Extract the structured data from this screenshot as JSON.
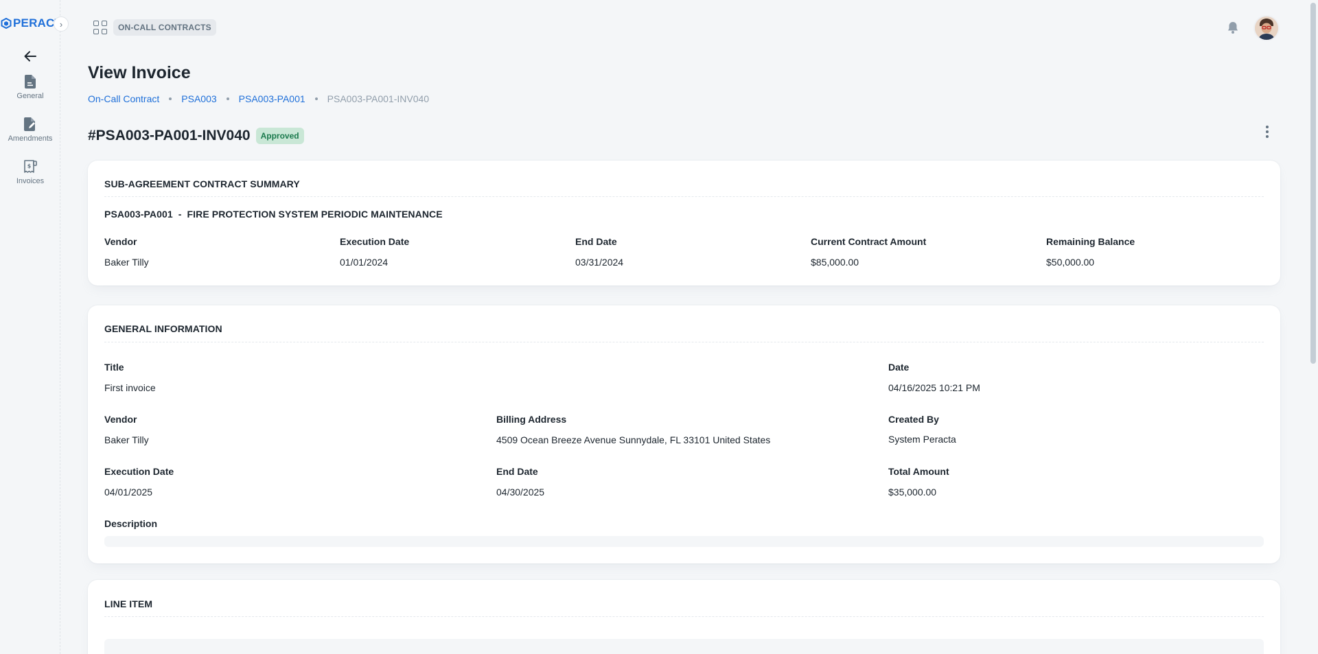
{
  "app": {
    "logo_text": "PERACT"
  },
  "sidebar": {
    "items": [
      {
        "label": "General",
        "icon": "document-icon"
      },
      {
        "label": "Amendments",
        "icon": "document-edit-icon"
      },
      {
        "label": "Invoices",
        "icon": "invoice-icon"
      }
    ]
  },
  "header": {
    "section_chip": "ON-CALL CONTRACTS"
  },
  "page": {
    "title": "View Invoice",
    "breadcrumb": [
      "On-Call Contract",
      "PSA003",
      "PSA003-PA001",
      "PSA003-PA001-INV040"
    ],
    "invoice_id": "#PSA003-PA001-INV040",
    "status": "Approved"
  },
  "summary": {
    "title": "SUB-AGREEMENT CONTRACT SUMMARY",
    "subtitle": "PSA003-PA001  -  FIRE PROTECTION SYSTEM PERIODIC MAINTENANCE",
    "fields": [
      {
        "label": "Vendor",
        "value": "Baker Tilly"
      },
      {
        "label": "Execution Date",
        "value": "01/01/2024"
      },
      {
        "label": "End Date",
        "value": "03/31/2024"
      },
      {
        "label": "Current Contract Amount",
        "value": "$85,000.00"
      },
      {
        "label": "Remaining Balance",
        "value": "$50,000.00"
      }
    ]
  },
  "general": {
    "title": "GENERAL INFORMATION",
    "title_field": {
      "label": "Title",
      "value": "First invoice"
    },
    "date": {
      "label": "Date",
      "value": "04/16/2025 10:21 PM"
    },
    "vendor": {
      "label": "Vendor",
      "value": "Baker Tilly"
    },
    "billing_address": {
      "label": "Billing Address",
      "value": "4509 Ocean Breeze Avenue Sunnydale, FL 33101 United States"
    },
    "created_by": {
      "label": "Created By",
      "value": "System Peracta"
    },
    "execution_date": {
      "label": "Execution Date",
      "value": "04/01/2025"
    },
    "end_date": {
      "label": "End Date",
      "value": "04/30/2025"
    },
    "total_amount": {
      "label": "Total Amount",
      "value": "$35,000.00"
    },
    "description": {
      "label": "Description",
      "value": ""
    }
  },
  "line_item": {
    "title": "LINE ITEM"
  },
  "colors": {
    "accent": "#1e6fd9",
    "success_bg": "#c9e7d6",
    "success_text": "#1b7a4d"
  }
}
